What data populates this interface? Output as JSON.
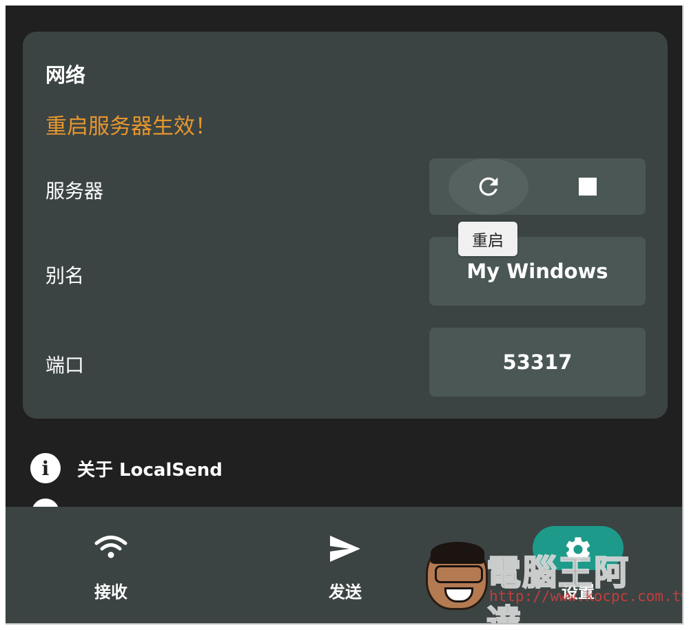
{
  "network": {
    "title": "网络",
    "warning": "重启服务器生效！",
    "server_label": "服务器",
    "restart_tooltip": "重启",
    "alias_label": "别名",
    "alias_value": "My Windows",
    "port_label": "端口",
    "port_value": "53317"
  },
  "about": {
    "label": "关于 LocalSend"
  },
  "nav": {
    "items": [
      {
        "label": "接收",
        "icon": "wifi-icon"
      },
      {
        "label": "发送",
        "icon": "send-icon"
      },
      {
        "label": "设置",
        "icon": "gear-icon"
      }
    ]
  },
  "watermark": {
    "title": "電腦王阿達",
    "url": "http://www.kocpc.com.tw"
  },
  "colors": {
    "background": "#202020",
    "card": "#3b4443",
    "field": "#4a5755",
    "warning": "#e8962e",
    "accent": "#1d9a8a"
  }
}
